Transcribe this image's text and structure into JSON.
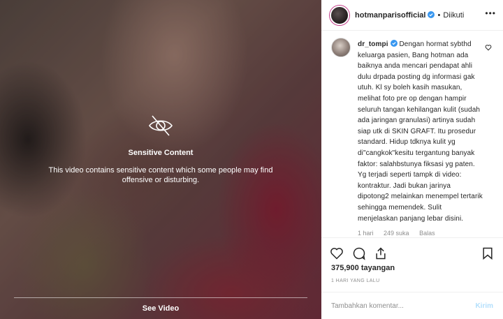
{
  "media": {
    "sensitive_title": "Sensitive Content",
    "sensitive_desc": "This video contains sensitive content which some people may find offensive or disturbing.",
    "see_video": "See Video",
    "icon": "eye-slash-icon"
  },
  "header": {
    "username": "hotmanparisofficial",
    "separator": "•",
    "follow_status": "Diikuti",
    "verified": true
  },
  "comment": {
    "username": "dr_tompi",
    "text": "Dengan hormat sybthd keluarga pasien, Bang hotman ada baiknya anda mencari pendapat ahli dulu drpada posting dg informasi gak utuh. Kl sy boleh kasih masukan, melihat foto pre op dengan hampir seluruh tangan kehilangan kulit (sudah ada jaringan granulasi) artinya sudah siap utk di SKIN GRAFT. Itu prosedur standard. Hidup tdknya kulit yg di\"cangkok\"kesitu tergantung banyak faktor: salahbstunya fiksasi yg paten. Yg terjadi seperti tampk di video: kontraktur. Jadi bukan jarinya dipotong2 melainkan menempel tertarik sehingga memendek. Sulit menjelaskan panjang lebar disini.",
    "time": "1 hari",
    "likes": "249 suka",
    "reply": "Balas"
  },
  "actions": {
    "views": "375,900 tayangan",
    "time_ago": "1 HARI YANG LALU"
  },
  "add_comment": {
    "placeholder": "Tambahkan komentar...",
    "post_label": "Kirim"
  },
  "colors": {
    "verified_blue": "#3897f0",
    "post_disabled": "#b2dffc",
    "text_primary": "#262626",
    "text_secondary": "#8e8e8e"
  }
}
